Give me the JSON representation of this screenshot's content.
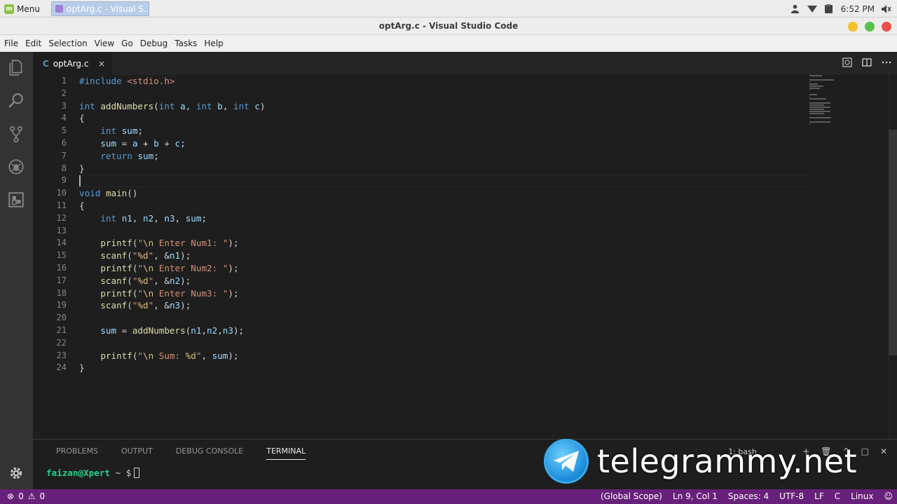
{
  "os_panel": {
    "menu_label": "Menu",
    "taskbar_item": "optArg.c - Visual S...",
    "clock": "6:52 PM"
  },
  "window": {
    "title": "optArg.c - Visual Studio Code"
  },
  "menubar": {
    "items": [
      "File",
      "Edit",
      "Selection",
      "View",
      "Go",
      "Debug",
      "Tasks",
      "Help"
    ]
  },
  "activitybar": {
    "icons": [
      "files-icon",
      "search-icon",
      "source-control-icon",
      "debug-icon",
      "extensions-icon",
      "settings-gear-icon"
    ]
  },
  "tab": {
    "lang_badge": "C",
    "filename": "optArg.c",
    "close": "×"
  },
  "editor": {
    "line_numbers": [
      "1",
      "2",
      "3",
      "4",
      "5",
      "6",
      "7",
      "8",
      "9",
      "10",
      "11",
      "12",
      "13",
      "14",
      "15",
      "16",
      "17",
      "18",
      "19",
      "20",
      "21",
      "22",
      "23",
      "24"
    ],
    "lines": [
      "#include <stdio.h>",
      "",
      "int addNumbers(int a, int b, int c)",
      "{",
      "    int sum;",
      "    sum = a + b + c;",
      "    return sum;",
      "}",
      "",
      "void main()",
      "{",
      "    int n1, n2, n3, sum;",
      "",
      "    printf(\"\\n Enter Num1: \");",
      "    scanf(\"%d\", &n1);",
      "    printf(\"\\n Enter Num2: \");",
      "    scanf(\"%d\", &n2);",
      "    printf(\"\\n Enter Num3: \");",
      "    scanf(\"%d\", &n3);",
      "",
      "    sum = addNumbers(n1,n2,n3);",
      "",
      "    printf(\"\\n Sum: %d\", sum);",
      "}"
    ],
    "cursor_line": 9
  },
  "panel": {
    "tabs": [
      "PROBLEMS",
      "OUTPUT",
      "DEBUG CONSOLE",
      "TERMINAL"
    ],
    "active_tab": "TERMINAL",
    "terminal_select": "1: bash",
    "terminal_user": "faizan@Xpert",
    "terminal_prompt": "~ $"
  },
  "watermark": {
    "text": "telegrammy.net"
  },
  "statusbar": {
    "errors": "0",
    "warnings": "0",
    "scope": "(Global Scope)",
    "position": "Ln 9, Col 1",
    "spaces": "Spaces: 4",
    "encoding": "UTF-8",
    "eol": "LF",
    "language": "C",
    "platform": "Linux"
  },
  "colors": {
    "statusbar_bg": "#68217a",
    "editor_bg": "#1e1e1e",
    "activitybar_bg": "#333333"
  }
}
